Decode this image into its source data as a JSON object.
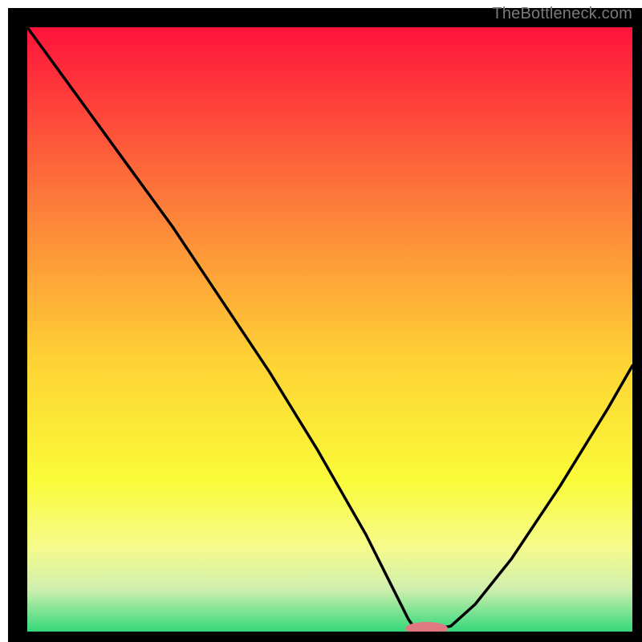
{
  "attribution": "TheBottleneck.com",
  "colors": {
    "frame": "#000000",
    "curve": "#000000",
    "marker_fill": "#e07882",
    "gradient_top": "#fe133b",
    "gradient_mid1": "#fd7f3a",
    "gradient_mid2": "#fed235",
    "gradient_mid3": "#fafb38",
    "gradient_mid4": "#f6fb8c",
    "gradient_mid5": "#cfefae",
    "gradient_bottom": "#34d87a"
  },
  "chart_data": {
    "type": "line",
    "title": "",
    "xlabel": "",
    "ylabel": "",
    "xlim": [
      0,
      100
    ],
    "ylim": [
      0,
      100
    ],
    "grid": false,
    "legend": false,
    "series": [
      {
        "name": "bottleneck-curve",
        "x": [
          0,
          8,
          16,
          24,
          32,
          40,
          48,
          56,
          60,
          63,
          64,
          66,
          68,
          70,
          74,
          80,
          88,
          96,
          100
        ],
        "values": [
          100,
          89,
          78,
          67,
          55,
          43,
          30,
          16,
          8,
          2,
          0.6,
          0.5,
          0.5,
          0.9,
          4.5,
          12,
          24,
          37,
          44
        ]
      }
    ],
    "marker": {
      "x": 66,
      "y": 0.5,
      "rx": 3.5,
      "ry": 1.1
    },
    "background_gradient_stops": [
      {
        "offset": 0.0,
        "color": "#fe133b"
      },
      {
        "offset": 0.3,
        "color": "#fd7f3a"
      },
      {
        "offset": 0.55,
        "color": "#fed235"
      },
      {
        "offset": 0.75,
        "color": "#fafb38"
      },
      {
        "offset": 0.86,
        "color": "#f6fb8c"
      },
      {
        "offset": 0.93,
        "color": "#cfefae"
      },
      {
        "offset": 1.0,
        "color": "#34d87a"
      }
    ]
  }
}
